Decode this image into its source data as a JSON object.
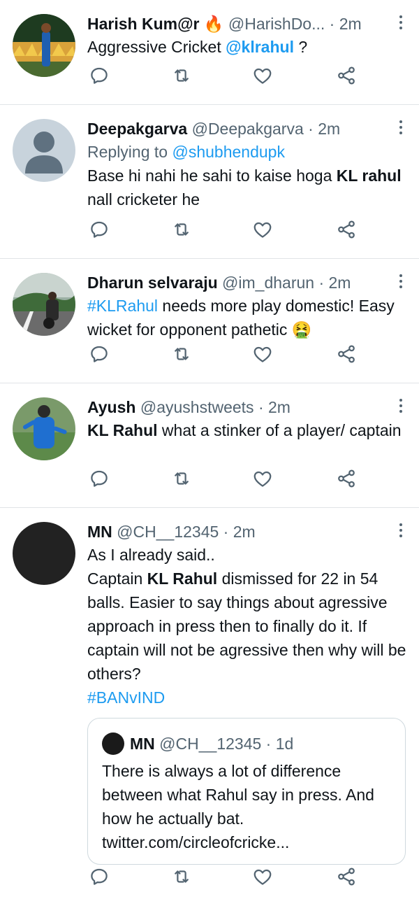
{
  "tweets": [
    {
      "name": "Harish Kum@r",
      "badge": "🔥",
      "handle": "@HarishDo...",
      "dot": "·",
      "time": "2m",
      "text_parts": [
        "Aggressive Cricket ",
        "@klrahul",
        " ?"
      ]
    },
    {
      "name": "Deepakgarva",
      "handle": "@Deepakgarva",
      "dot": "·",
      "time": "2m",
      "replying_prefix": "Replying to ",
      "replying_to": "@shubhendupk",
      "text_parts": [
        "Base hi nahi he sahi to kaise hoga ",
        "KL rahul",
        " nall cricketer he"
      ]
    },
    {
      "name": "Dharun selvaraju",
      "handle": "@im_dharun",
      "dot": "·",
      "time": "2m",
      "text_parts": [
        "#KLRahul",
        " needs more play domestic! Easy wicket for opponent pathetic ",
        "🤮"
      ]
    },
    {
      "name": "Ayush",
      "handle": "@ayushstweets",
      "dot": "·",
      "time": "2m",
      "text_parts": [
        "KL Rahul",
        " what a stinker of a player/ captain"
      ]
    },
    {
      "name": "MN",
      "handle": "@CH__12345",
      "dot": "·",
      "time": "2m",
      "text_parts": [
        "As I already said..",
        "Captain ",
        "KL Rahul",
        " dismissed for 22 in 54 balls. Easier to say things about agressive approach in press then to finally do it. If captain will not be agressive then why will be others?",
        "#BANvIND"
      ],
      "quote": {
        "name": "MN",
        "handle": "@CH__12345",
        "dot": "·",
        "time": "1d",
        "text": "There is always a lot of difference between what Rahul say in press. And how he actually bat. twitter.com/circleofcricke..."
      }
    }
  ],
  "icons": [
    "reply-icon",
    "retweet-icon",
    "like-icon",
    "share-icon",
    "more-icon"
  ],
  "colors": {
    "link": "#1d9bf0",
    "secondary": "#536471",
    "divider": "#e1e4e7"
  }
}
